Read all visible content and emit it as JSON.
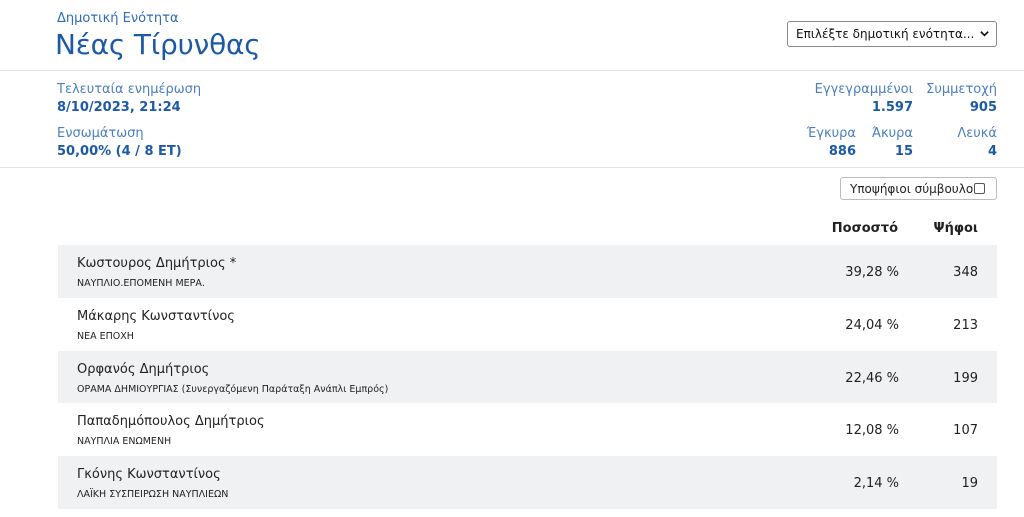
{
  "header": {
    "subtitle": "Δημοτική Ενότητα",
    "title": "Νέας Τίρυνθας",
    "select_value": "Επιλέξτε δημοτική ενότητα..."
  },
  "stats": {
    "last_update_label": "Τελευταία ενημέρωση",
    "last_update_value": "8/10/2023, 21:24",
    "integration_label": "Ενσωμάτωση",
    "integration_value": "50,00% (4 / 8 ΕΤ)",
    "registered_label": "Εγγεγραμμένοι",
    "registered_value": "1.597",
    "turnout_label": "Συμμετοχή",
    "turnout_value": "905",
    "valid_label": "Έγκυρα",
    "valid_value": "886",
    "invalid_label": "Άκυρα",
    "invalid_value": "15",
    "blank_label": "Λευκά",
    "blank_value": "4"
  },
  "toggle": {
    "label": "Υποψήφιοι σύμβουλοι",
    "checked": false
  },
  "table": {
    "headers": {
      "percent": "Ποσοστό",
      "votes": "Ψήφοι"
    },
    "rows": [
      {
        "name": "Κωστουρος Δημήτριος *",
        "party": "ΝΑΥΠΛΙΟ.ΕΠΟΜΕΝΗ ΜΕΡΑ.",
        "percent": "39,28 %",
        "votes": "348"
      },
      {
        "name": "Μάκαρης Κωνσταντίνος",
        "party": "ΝΕΑ ΕΠΟΧΗ",
        "percent": "24,04 %",
        "votes": "213"
      },
      {
        "name": "Ορφανός Δημήτριος",
        "party": "ΟΡΑΜΑ ΔΗΜΙΟΥΡΓΙΑΣ (Συνεργαζόμενη Παράταξη Ανάπλι Εμπρός)",
        "percent": "22,46 %",
        "votes": "199"
      },
      {
        "name": "Παπαδημόπουλος Δημήτριος",
        "party": "ΝΑΥΠΛΙΑ ΕΝΩΜΕΝΗ",
        "percent": "12,08 %",
        "votes": "107"
      },
      {
        "name": "Γκόνης Κωνσταντίνος",
        "party": "ΛΑΪΚΗ ΣΥΣΠΕΙΡΩΣΗ ΝΑΥΠΛΙΕΩΝ",
        "percent": "2,14 %",
        "votes": "19"
      }
    ]
  },
  "colors": {
    "accent": "#1d5aa6",
    "label": "#4a7fc1",
    "row_alt": "#f0f1f2"
  },
  "icons": {
    "select": "chevron-down-icon",
    "toggle": "checkbox-icon"
  }
}
